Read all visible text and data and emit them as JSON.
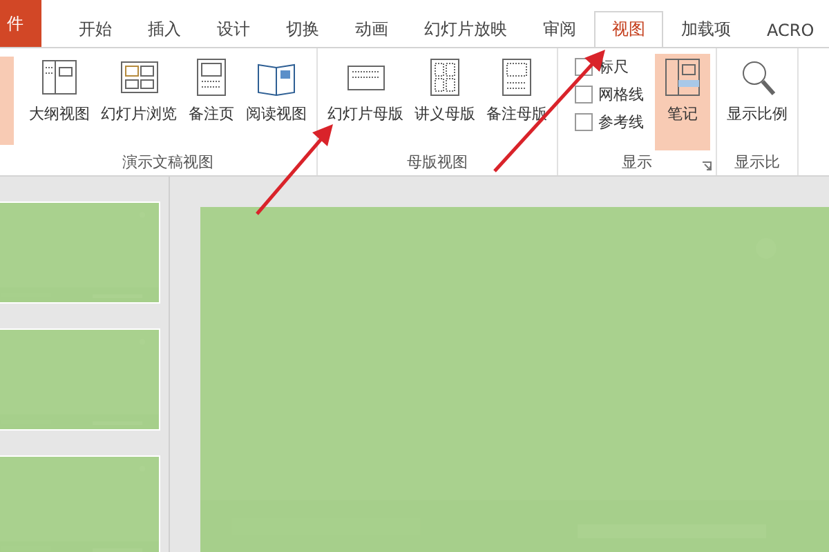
{
  "tabs": [
    {
      "label": "件",
      "kind": "file",
      "selected": false
    },
    {
      "label": "开始",
      "kind": "tab",
      "selected": false
    },
    {
      "label": "插入",
      "kind": "tab",
      "selected": false
    },
    {
      "label": "设计",
      "kind": "tab",
      "selected": false
    },
    {
      "label": "切换",
      "kind": "tab",
      "selected": false
    },
    {
      "label": "动画",
      "kind": "tab",
      "selected": false
    },
    {
      "label": "幻灯片放映",
      "kind": "tab",
      "selected": false
    },
    {
      "label": "审阅",
      "kind": "tab",
      "selected": false
    },
    {
      "label": "视图",
      "kind": "tab",
      "selected": true
    },
    {
      "label": "加载项",
      "kind": "tab",
      "selected": false
    },
    {
      "label": "ACRO",
      "kind": "tab",
      "selected": false
    }
  ],
  "ribbon": {
    "partial_button": {
      "selected": true
    },
    "groups": [
      {
        "label": "演示文稿视图",
        "items": [
          {
            "kind": "button",
            "label": "大纲视图",
            "selected": false
          },
          {
            "kind": "button",
            "label": "幻灯片浏览",
            "selected": false
          },
          {
            "kind": "button",
            "label": "备注页",
            "selected": false
          },
          {
            "kind": "button",
            "label": "阅读视图",
            "selected": false
          }
        ]
      },
      {
        "label": "母版视图",
        "items": [
          {
            "kind": "button",
            "label": "幻灯片母版",
            "selected": false
          },
          {
            "kind": "button",
            "label": "讲义母版",
            "selected": false
          },
          {
            "kind": "button",
            "label": "备注母版",
            "selected": false
          }
        ]
      },
      {
        "label": "显示",
        "launcher": true,
        "items": [
          {
            "kind": "checks",
            "checks": [
              {
                "label": "标尺",
                "checked": false
              },
              {
                "label": "网格线",
                "checked": false
              },
              {
                "label": "参考线",
                "checked": false
              }
            ]
          },
          {
            "kind": "button",
            "label": "笔记",
            "selected": true
          }
        ]
      },
      {
        "label": "显示比",
        "items": [
          {
            "kind": "button",
            "label": "显示比例",
            "selected": false
          }
        ]
      }
    ]
  }
}
